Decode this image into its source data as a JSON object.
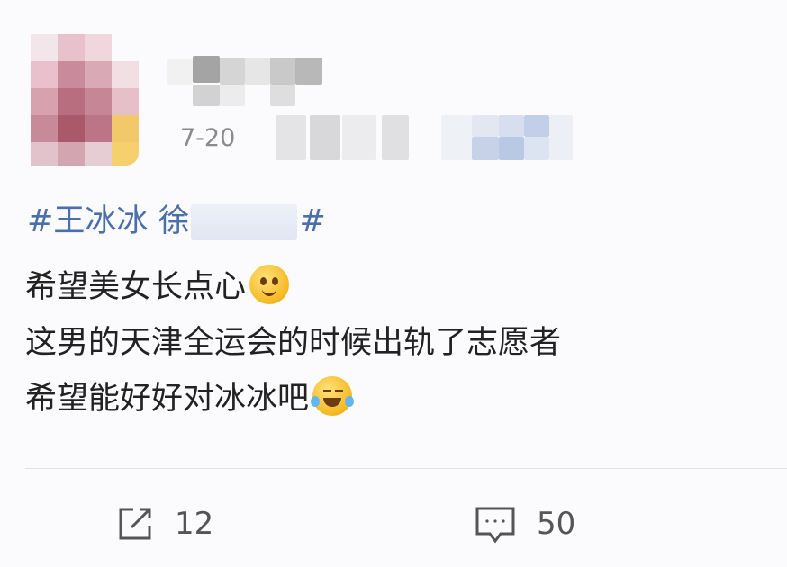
{
  "post": {
    "timestamp": "7-20",
    "topic_start": "#王冰冰 徐",
    "topic_end": "#",
    "lines": [
      "希望美女长点心",
      "这男的天津全运会的时候出轨了志愿者",
      "希望能好好对冰冰吧"
    ],
    "emoji_1": "drooling-face-icon",
    "emoji_2": "laughing-tears-icon"
  },
  "actions": {
    "repost_icon": "repost-icon",
    "repost_count": "12",
    "comment_icon": "comment-icon",
    "comment_count": "50"
  },
  "colors": {
    "background": "#fbfbfd",
    "topic": "#4b6fa8",
    "text": "#222222",
    "meta": "#8a8a8a"
  }
}
